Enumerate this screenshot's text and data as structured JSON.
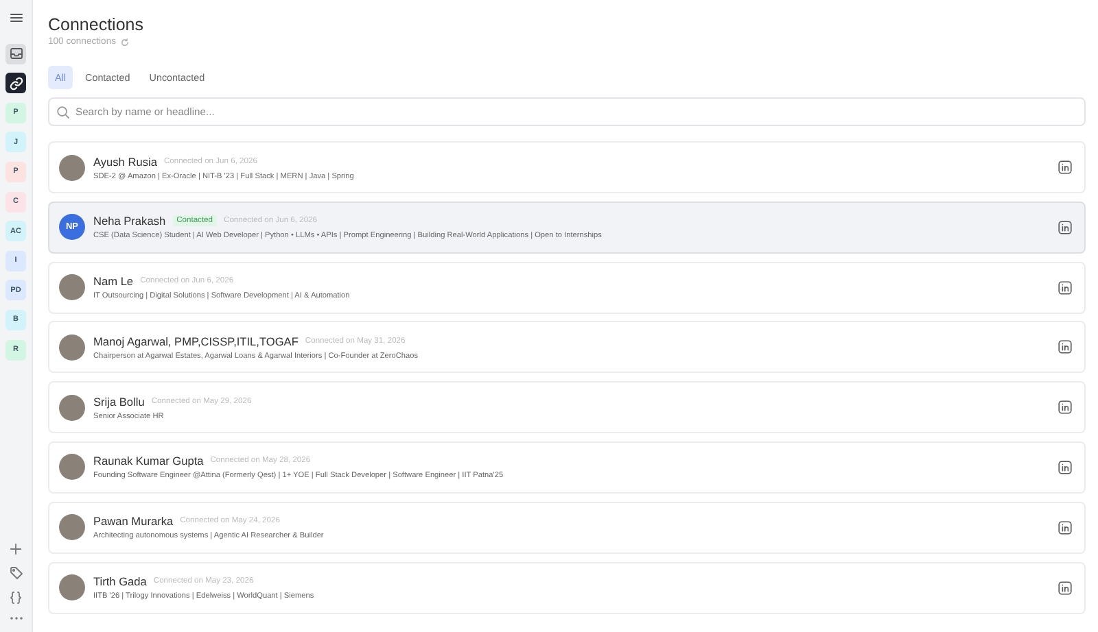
{
  "sidebar": {
    "nav": [
      {
        "selected": false
      },
      {
        "selected": true
      }
    ],
    "spaces": [
      {
        "label": "P",
        "color": "#d3f5e4"
      },
      {
        "label": "J",
        "color": "#d2f3fa"
      },
      {
        "label": "P",
        "color": "#fde2e2"
      },
      {
        "label": "C",
        "color": "#fbe3e8"
      },
      {
        "label": "AC",
        "color": "#d2f3fa"
      },
      {
        "label": "I",
        "color": "#dbe8fd"
      },
      {
        "label": "PD",
        "color": "#dbe8fd"
      },
      {
        "label": "B",
        "color": "#d2f3fa"
      },
      {
        "label": "R",
        "color": "#d3f5e4"
      }
    ]
  },
  "header": {
    "title": "Connections",
    "count": "100 connections"
  },
  "tabs": [
    {
      "label": "All",
      "selected": true
    },
    {
      "label": "Contacted",
      "selected": false
    },
    {
      "label": "Uncontacted",
      "selected": false
    }
  ],
  "search": {
    "placeholder": "Search by name or headline..."
  },
  "connections": [
    {
      "name": "Ayush Rusia",
      "connected": "Connected on Jun 6, 2026",
      "headline": "SDE-2 @ Amazon | Ex-Oracle | NIT-B '23 | Full Stack | MERN | Java | Spring",
      "selected": false
    },
    {
      "name": "Neha Prakash",
      "initials": "NP",
      "status": "Contacted",
      "connected": "Connected on Jun 6, 2026",
      "headline": "CSE (Data Science) Student | AI Web Developer | Python • LLMs • APIs | Prompt Engineering | Building Real-World Applications | Open to Internships",
      "selected": true
    },
    {
      "name": "Nam Le",
      "connected": "Connected on Jun 6, 2026",
      "headline": "IT Outsourcing | Digital Solutions | Software Development | AI & Automation",
      "selected": false
    },
    {
      "name": "Manoj Agarwal, PMP,CISSP,ITIL,TOGAF",
      "connected": "Connected on May 31, 2026",
      "headline": "Chairperson at Agarwal Estates, Agarwal Loans & Agarwal Interiors | Co-Founder at ZeroChaos",
      "selected": false
    },
    {
      "name": "Srija Bollu",
      "connected": "Connected on May 29, 2026",
      "headline": "Senior Associate HR",
      "selected": false
    },
    {
      "name": "Raunak Kumar Gupta",
      "connected": "Connected on May 28, 2026",
      "headline": "Founding Software Engineer @Attina (Formerly Qest) | 1+ YOE | Full Stack Developer | Software Engineer | IIT Patna'25",
      "selected": false
    },
    {
      "name": "Pawan Murarka",
      "connected": "Connected on May 24, 2026",
      "headline": "Architecting autonomous systems | Agentic AI Researcher & Builder",
      "selected": false
    },
    {
      "name": "Tirth Gada",
      "connected": "Connected on May 23, 2026",
      "headline": "IITB '26 | Trilogy Innovations | Edelweiss | WorldQuant | Siemens",
      "selected": false
    }
  ]
}
